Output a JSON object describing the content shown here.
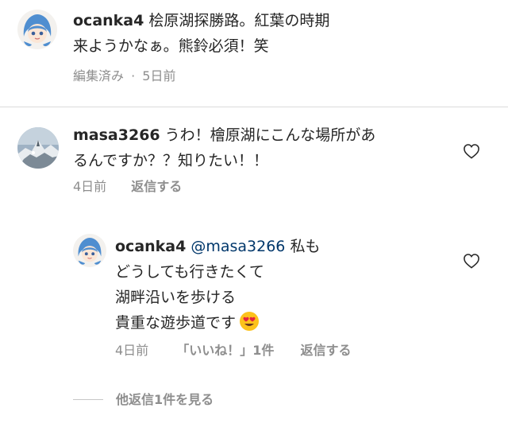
{
  "comment1": {
    "username": "ocanka4",
    "lines": [
      "桧原湖探勝路。紅葉の時期",
      "来ようかなぁ。熊鈴必須！笑"
    ],
    "meta_edited": "編集済み",
    "meta_sep": "·",
    "meta_time": "5日前"
  },
  "comment2": {
    "username": "masa3266",
    "lines": [
      "うわ！檜原湖にこんな場所があ",
      "るんですか？？知りたい！！"
    ],
    "meta_time": "4日前",
    "reply_label": "返信する"
  },
  "reply1": {
    "username": "ocanka4",
    "mention": "@masa3266",
    "lines": [
      "私も",
      "どうしても行きたくて",
      "湖畔沿いを歩ける",
      "貴重な遊歩道です"
    ],
    "emoji": "smiling-face-with-heart-eyes",
    "meta_time": "4日前",
    "likes_label": "「いいね！」1件",
    "reply_label": "返信する"
  },
  "more_replies_label": "他返信1件を見る",
  "colors": {
    "text": "#262626",
    "secondary": "#8e8e8e",
    "mention": "#00376b",
    "divider": "#dbdbdb"
  }
}
